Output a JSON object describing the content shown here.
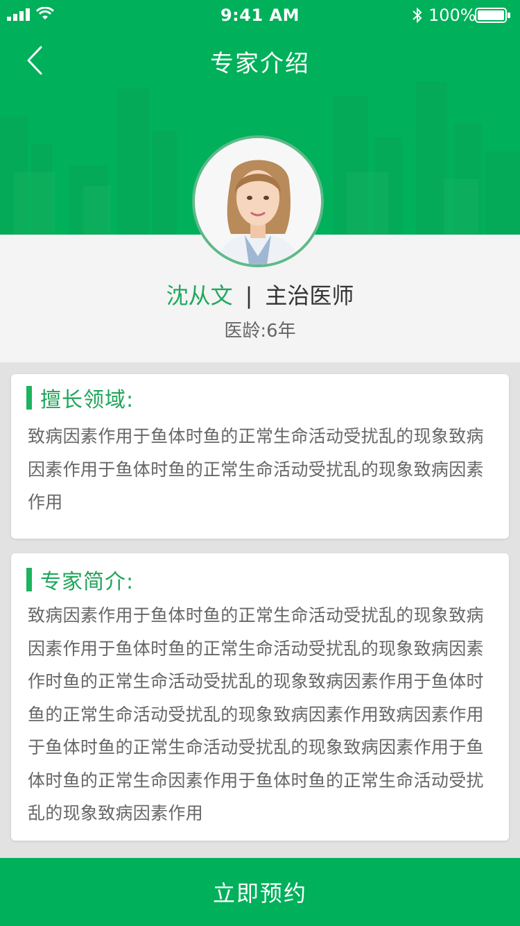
{
  "status_bar": {
    "time": "9:41 AM",
    "battery": "100%",
    "icons": [
      "signal-icon",
      "wifi-icon",
      "bluetooth-icon",
      "battery-icon"
    ]
  },
  "nav": {
    "title": "专家介绍",
    "back_icon": "chevron-left-icon"
  },
  "doctor": {
    "name": "沈从文",
    "separator": "|",
    "title": "主治医师",
    "experience": "医龄:6年"
  },
  "specialty": {
    "heading": "擅长领域:",
    "text": "致病因素作用于鱼体时鱼的正常生命活动受扰乱的现象致病因素作用于鱼体时鱼的正常生命活动受扰乱的现象致病因素作用"
  },
  "intro": {
    "heading": "专家简介:",
    "text": "致病因素作用于鱼体时鱼的正常生命活动受扰乱的现象致病因素作用于鱼体时鱼的正常生命活动受扰乱的现象致病因素作时鱼的正常生命活动受扰乱的现象致病因素作用于鱼体时鱼的正常生命活动受扰乱的现象致病因素作用致病因素作用于鱼体时鱼的正常生命活动受扰乱的现象致病因素作用于鱼体时鱼的正常生命因素作用于鱼体时鱼的正常生命活动受扰乱的现象致病因素作用"
  },
  "actions": {
    "book_label": "立即预约"
  },
  "colors": {
    "primary": "#00b05a",
    "accent_text": "#21a85e",
    "body_text": "#666666",
    "background": "#e2e2e2"
  }
}
